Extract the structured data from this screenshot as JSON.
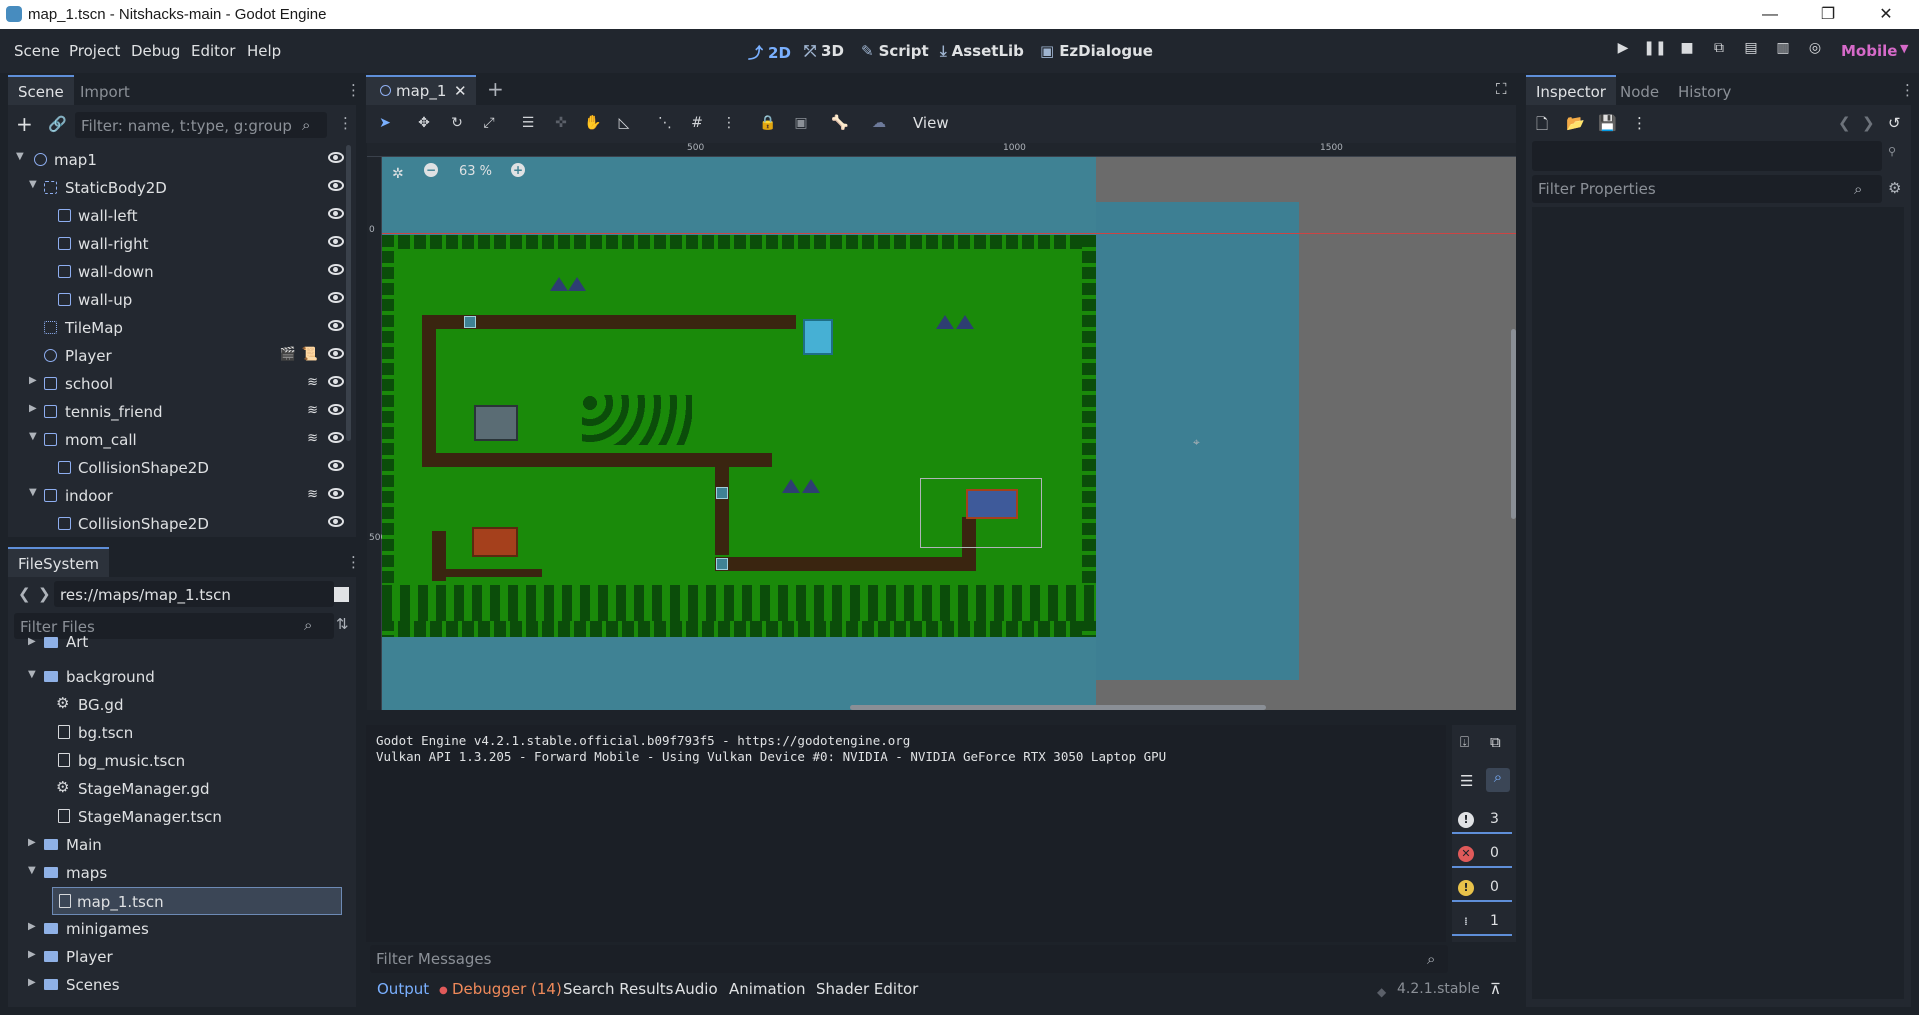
{
  "window": {
    "title": "map_1.tscn - Nitshacks-main - Godot Engine",
    "minimize": "—",
    "maximize": "❐",
    "close": "✕"
  },
  "menu": {
    "items": [
      "Scene",
      "Project",
      "Debug",
      "Editor",
      "Help"
    ]
  },
  "workspaces": {
    "btn_2d": "2D",
    "btn_3d": "3D",
    "btn_script": "Script",
    "btn_assetlib": "AssetLib",
    "btn_ezdialogue": "EzDialogue"
  },
  "renderer": "Mobile",
  "scene_dock": {
    "tabs": [
      "Scene",
      "Import"
    ],
    "filter_placeholder": "Filter: name, t:type, g:group",
    "nodes": [
      {
        "label": "map1"
      },
      {
        "label": "StaticBody2D"
      },
      {
        "label": "wall-left"
      },
      {
        "label": "wall-right"
      },
      {
        "label": "wall-down"
      },
      {
        "label": "wall-up"
      },
      {
        "label": "TileMap"
      },
      {
        "label": "Player"
      },
      {
        "label": "school"
      },
      {
        "label": "tennis_friend"
      },
      {
        "label": "mom_call"
      },
      {
        "label": "CollisionShape2D"
      },
      {
        "label": "indoor"
      },
      {
        "label": "CollisionShape2D"
      }
    ]
  },
  "filesystem": {
    "tab": "FileSystem",
    "path": "res://maps/map_1.tscn",
    "filter_placeholder": "Filter Files",
    "items": [
      {
        "label": "Art"
      },
      {
        "label": "background"
      },
      {
        "label": "BG.gd"
      },
      {
        "label": "bg.tscn"
      },
      {
        "label": "bg_music.tscn"
      },
      {
        "label": "StageManager.gd"
      },
      {
        "label": "StageManager.tscn"
      },
      {
        "label": "Main"
      },
      {
        "label": "maps"
      },
      {
        "label": "map_1.tscn"
      },
      {
        "label": "minigames"
      },
      {
        "label": "Player"
      },
      {
        "label": "Scenes"
      }
    ]
  },
  "editor": {
    "scene_tab": "map_1",
    "view_menu": "View",
    "zoom": "63 %",
    "ruler": [
      "500",
      "1000",
      "1500"
    ],
    "ruler_v": [
      "0",
      "500"
    ]
  },
  "output": {
    "lines": [
      "Godot Engine v4.2.1.stable.official.b09f793f5 - https://godotengine.org",
      "Vulkan API 1.3.205 - Forward Mobile - Using Vulkan Device #0: NVIDIA - NVIDIA GeForce RTX 3050 Laptop GPU"
    ],
    "filter_placeholder": "Filter Messages",
    "counts": {
      "messages": "3",
      "errors": "0",
      "warnings": "0",
      "other": "1"
    }
  },
  "bottom_tabs": {
    "output": "Output",
    "debugger": "Debugger (14)",
    "search": "Search Results",
    "audio": "Audio",
    "animation": "Animation",
    "shader": "Shader Editor"
  },
  "version": "4.2.1.stable",
  "inspector": {
    "tabs": [
      "Inspector",
      "Node",
      "History"
    ],
    "filter_placeholder": "Filter Properties"
  }
}
